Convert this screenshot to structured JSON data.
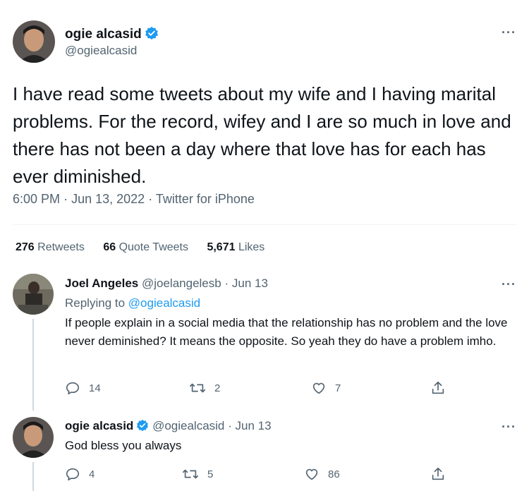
{
  "tweet": {
    "author_name": "ogie alcasid",
    "author_handle": "@ogiealcasid",
    "text": "I have read some tweets about my wife and I having marital problems. For the record, wifey and I are so much in love and there has not been a day where that love has for each has ever diminished.",
    "time": "6:00 PM",
    "date": "Jun 13, 2022",
    "source": "Twitter for iPhone",
    "dot": "·",
    "more": "···"
  },
  "stats": {
    "retweets_count": "276",
    "retweets_label": "Retweets",
    "quotes_count": "66",
    "quotes_label": "Quote Tweets",
    "likes_count": "5,671",
    "likes_label": "Likes"
  },
  "replies": [
    {
      "author_name": "Joel Angeles",
      "author_handle": "@joelangelesb",
      "dot": "·",
      "date": "Jun 13",
      "replying_prefix": "Replying to",
      "replying_to": "@ogiealcasid",
      "text": "If people explain in a social media that the relationship has no problem and the love never deminished? It means the opposite. So yeah they do have a problem imho.",
      "replies": "14",
      "retweets": "2",
      "likes": "7",
      "more": "···"
    },
    {
      "author_name": "ogie alcasid",
      "author_handle": "@ogiealcasid",
      "dot": "·",
      "date": "Jun 13",
      "text": "God bless you always",
      "replies": "4",
      "retweets": "5",
      "likes": "86",
      "more": "···"
    }
  ],
  "colors": {
    "accent": "#1d9bf0",
    "muted": "#536471",
    "text": "#0f1419",
    "divider": "#eff3f4"
  },
  "icons": [
    "verified-badge-icon",
    "more-icon",
    "reply-icon",
    "retweet-icon",
    "like-icon",
    "share-icon"
  ]
}
